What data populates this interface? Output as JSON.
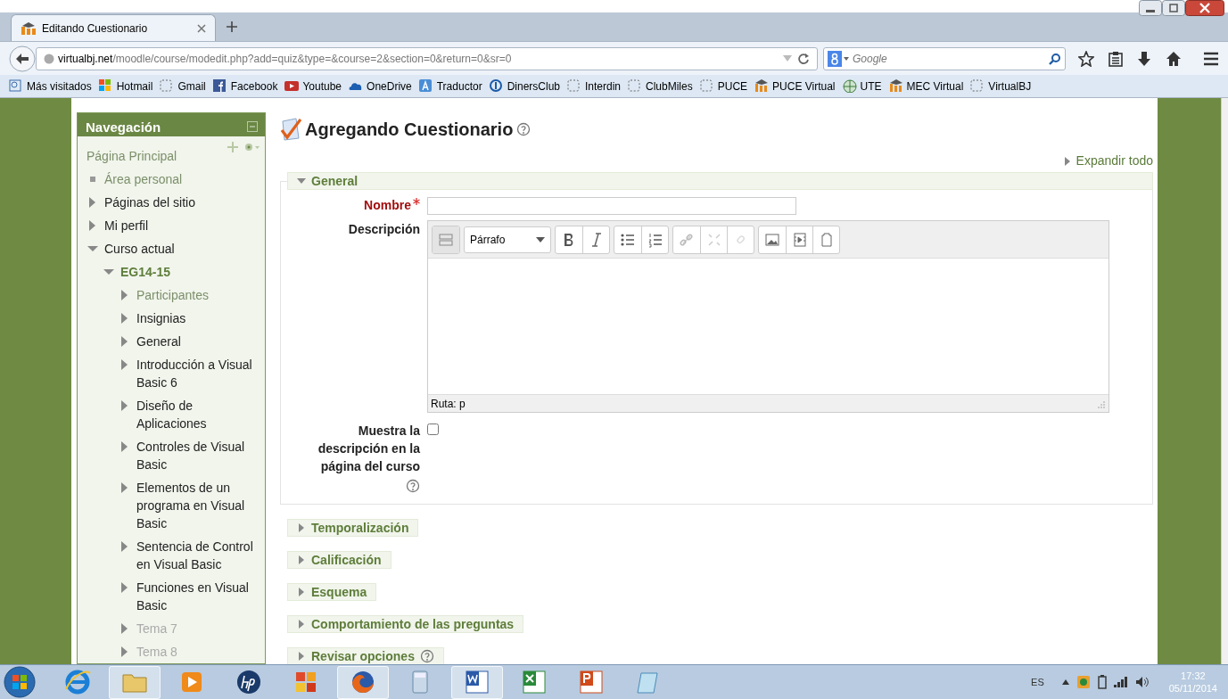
{
  "browser": {
    "tabs": [
      {
        "title": "Editando Cuestionario",
        "selected": true
      }
    ],
    "url_host": "virtualbj.net",
    "url_path": "/moodle/course/modedit.php?add=quiz&type=&course=2&section=0&return=0&sr=0",
    "search_placeholder": "Google",
    "bookmarks": [
      {
        "label": "Más visitados",
        "kind": "page"
      },
      {
        "label": "Hotmail",
        "kind": "windows"
      },
      {
        "label": "Gmail",
        "kind": "blank"
      },
      {
        "label": "Facebook",
        "kind": "facebook"
      },
      {
        "label": "Youtube",
        "kind": "video"
      },
      {
        "label": "OneDrive",
        "kind": "cloud"
      },
      {
        "label": "Traductor",
        "kind": "translate"
      },
      {
        "label": "DinersClub",
        "kind": "ring"
      },
      {
        "label": "Interdin",
        "kind": "blank"
      },
      {
        "label": "ClubMiles",
        "kind": "blank"
      },
      {
        "label": "PUCE",
        "kind": "blank"
      },
      {
        "label": "PUCE Virtual",
        "kind": "hat"
      },
      {
        "label": "UTE",
        "kind": "globe"
      },
      {
        "label": "MEC Virtual",
        "kind": "hat"
      },
      {
        "label": "VirtualBJ",
        "kind": "blank"
      }
    ]
  },
  "sidebar": {
    "title": "Navegación",
    "items": [
      {
        "label": "Página Principal",
        "kind": "home"
      },
      {
        "label": "Área personal",
        "kind": "bullet"
      },
      {
        "label": "Páginas del sitio",
        "kind": "branch",
        "expanded": false
      },
      {
        "label": "Mi perfil",
        "kind": "branch",
        "expanded": false
      },
      {
        "label": "Curso actual",
        "kind": "branch",
        "expanded": true,
        "children": [
          {
            "label": "EG14-15",
            "kind": "course",
            "expanded": true,
            "children": [
              {
                "label": "Participantes",
                "kind": "link",
                "expanded": false
              },
              {
                "label": "Insignias",
                "kind": "branch",
                "expanded": false
              },
              {
                "label": "General",
                "kind": "branch",
                "expanded": false
              },
              {
                "label": "Introducción a Visual Basic 6",
                "kind": "branch",
                "expanded": false
              },
              {
                "label": "Diseño de Aplicaciones",
                "kind": "branch",
                "expanded": false
              },
              {
                "label": "Controles de Visual Basic",
                "kind": "branch",
                "expanded": false
              },
              {
                "label": "Elementos de un programa en Visual Basic",
                "kind": "branch",
                "expanded": false
              },
              {
                "label": "Sentencia de Control en Visual Basic",
                "kind": "branch",
                "expanded": false
              },
              {
                "label": "Funciones en Visual Basic",
                "kind": "branch",
                "expanded": false
              },
              {
                "label": "Tema 7",
                "kind": "hidden",
                "expanded": false
              },
              {
                "label": "Tema 8",
                "kind": "hidden",
                "expanded": false
              }
            ]
          }
        ]
      }
    ]
  },
  "main": {
    "heading": "Agregando Cuestionario",
    "expand_all": "Expandir todo",
    "general": {
      "title": "General",
      "expanded": true,
      "name_label": "Nombre",
      "name_required": true,
      "description_label": "Descripción",
      "format": "Párrafo",
      "editor_path": "Ruta: p",
      "show_label": "Muestra la descripción en la página del curso",
      "show_checked": false
    },
    "sections": [
      {
        "title": "Temporalización",
        "expanded": false,
        "help": false
      },
      {
        "title": "Calificación",
        "expanded": false,
        "help": false
      },
      {
        "title": "Esquema",
        "expanded": false,
        "help": false
      },
      {
        "title": "Comportamiento de las preguntas",
        "expanded": false,
        "help": false
      },
      {
        "title": "Revisar opciones",
        "expanded": false,
        "help": true
      }
    ]
  },
  "taskbar": {
    "apps": [
      {
        "kind": "ie",
        "running": false
      },
      {
        "kind": "folder",
        "running": true
      },
      {
        "kind": "media",
        "running": false
      },
      {
        "kind": "hp",
        "running": false
      },
      {
        "kind": "office",
        "running": false
      },
      {
        "kind": "firefox",
        "running": true
      },
      {
        "kind": "calculator",
        "running": false
      },
      {
        "kind": "word",
        "running": true
      },
      {
        "kind": "excel",
        "running": false
      },
      {
        "kind": "powerpoint",
        "running": false
      },
      {
        "kind": "notepad",
        "running": false
      }
    ],
    "language": "ES",
    "time": "17:32",
    "date": "05/11/2014"
  }
}
